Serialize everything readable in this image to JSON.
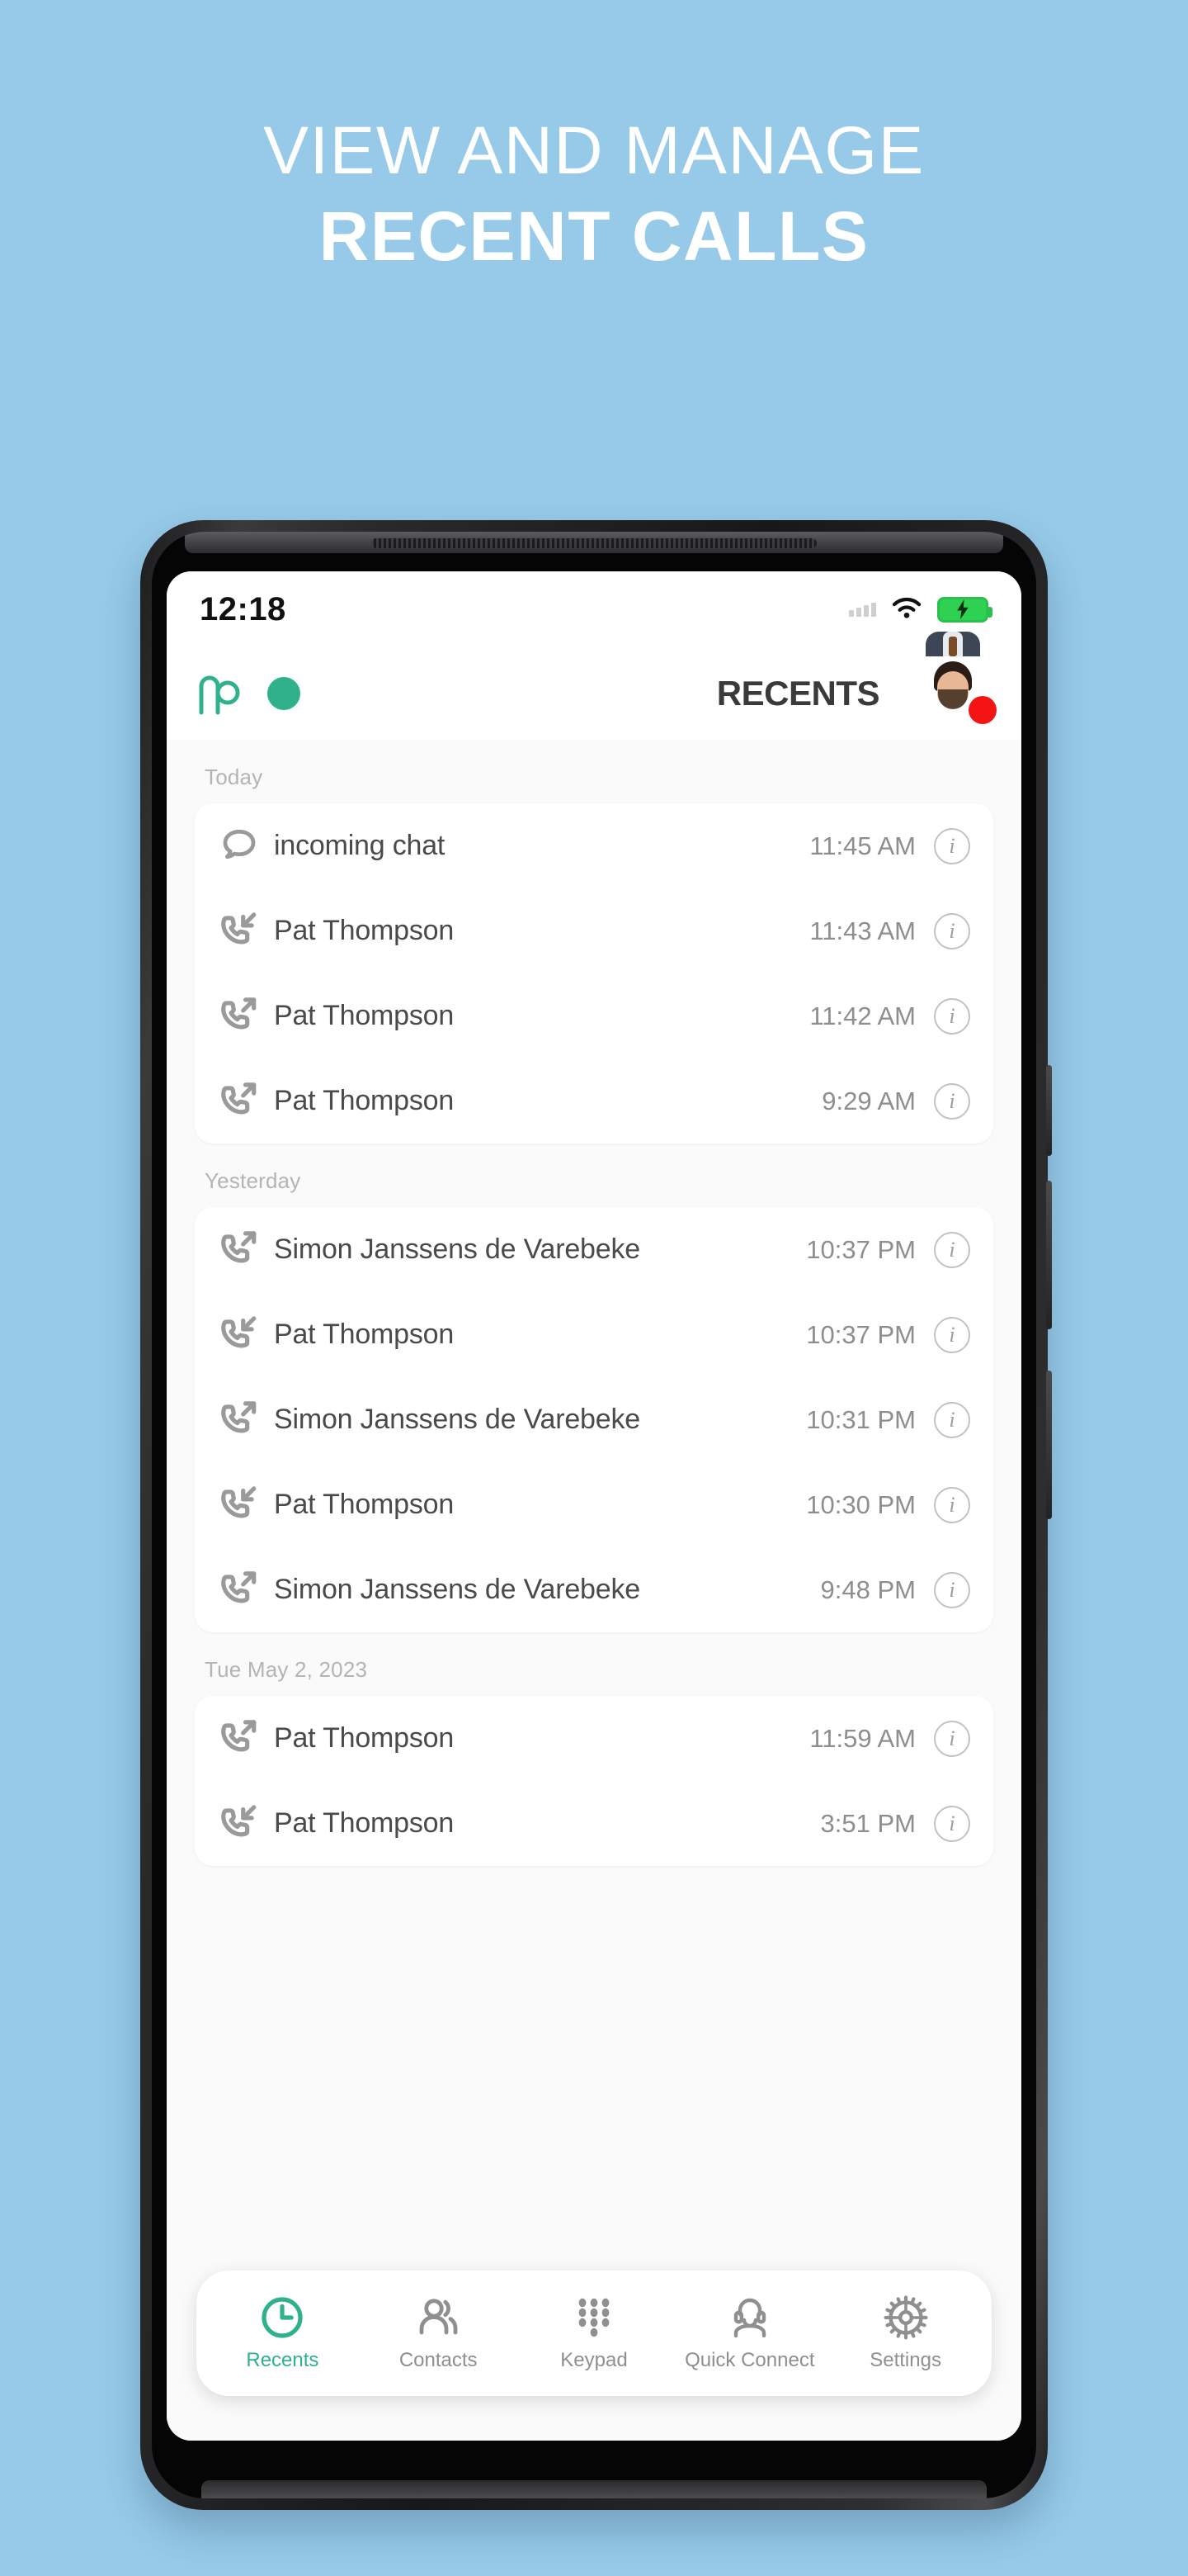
{
  "promo": {
    "line1": "VIEW AND MANAGE",
    "line2": "RECENT CALLS"
  },
  "colors": {
    "background": "#96cae8",
    "accent_teal": "#2fb28c",
    "badge_red": "#f51414",
    "battery_green": "#2fd152",
    "screen_bg": "#fafafa",
    "text_primary": "#4a4a4a",
    "text_muted": "#8e8e8e",
    "section_label": "#b4b4b4"
  },
  "status_bar": {
    "time": "12:18",
    "signal_icon": "signal-dots-icon",
    "wifi_icon": "wifi-icon",
    "battery_icon": "battery-charging-icon"
  },
  "app_header": {
    "logo_icon": "mc-logo-icon",
    "presence_icon": "presence-dot-icon",
    "title": "RECENTS",
    "avatar_icon": "user-avatar",
    "avatar_badge_icon": "status-badge-red"
  },
  "sections": [
    {
      "label": "Today",
      "rows": [
        {
          "icon": "chat-bubble-icon",
          "type": "chat",
          "name": "incoming chat",
          "time": "11:45 AM",
          "info_icon": "info-icon"
        },
        {
          "icon": "call-incoming-icon",
          "type": "incoming",
          "name": "Pat Thompson",
          "time": "11:43 AM",
          "info_icon": "info-icon"
        },
        {
          "icon": "call-outgoing-icon",
          "type": "outgoing",
          "name": "Pat Thompson",
          "time": "11:42 AM",
          "info_icon": "info-icon"
        },
        {
          "icon": "call-outgoing-icon",
          "type": "outgoing",
          "name": "Pat Thompson",
          "time": "9:29 AM",
          "info_icon": "info-icon"
        }
      ]
    },
    {
      "label": "Yesterday",
      "rows": [
        {
          "icon": "call-outgoing-icon",
          "type": "outgoing",
          "name": "Simon Janssens de Varebeke",
          "time": "10:37 PM",
          "info_icon": "info-icon"
        },
        {
          "icon": "call-incoming-icon",
          "type": "incoming",
          "name": "Pat Thompson",
          "time": "10:37 PM",
          "info_icon": "info-icon"
        },
        {
          "icon": "call-outgoing-icon",
          "type": "outgoing",
          "name": "Simon Janssens de Varebeke",
          "time": "10:31 PM",
          "info_icon": "info-icon"
        },
        {
          "icon": "call-incoming-icon",
          "type": "incoming",
          "name": "Pat Thompson",
          "time": "10:30 PM",
          "info_icon": "info-icon"
        },
        {
          "icon": "call-outgoing-icon",
          "type": "outgoing",
          "name": "Simon Janssens de Varebeke",
          "time": "9:48 PM",
          "info_icon": "info-icon"
        }
      ]
    },
    {
      "label": "Tue May 2, 2023",
      "rows": [
        {
          "icon": "call-outgoing-icon",
          "type": "outgoing",
          "name": "Pat Thompson",
          "time": "11:59 AM",
          "info_icon": "info-icon"
        },
        {
          "icon": "call-incoming-icon",
          "type": "incoming",
          "name": "Pat Thompson",
          "time": "3:51 PM",
          "info_icon": "info-icon"
        }
      ]
    }
  ],
  "tabbar": {
    "active": "Recents",
    "tabs": [
      {
        "label": "Recents",
        "icon": "clock-icon"
      },
      {
        "label": "Contacts",
        "icon": "people-icon"
      },
      {
        "label": "Keypad",
        "icon": "keypad-dots-icon"
      },
      {
        "label": "Quick Connect",
        "icon": "headset-person-icon"
      },
      {
        "label": "Settings",
        "icon": "gear-icon"
      }
    ]
  }
}
